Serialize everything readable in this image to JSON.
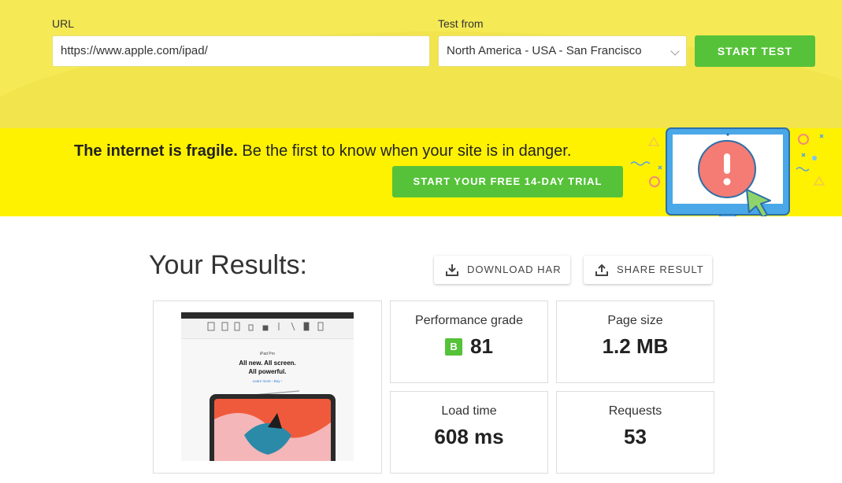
{
  "form": {
    "url_label": "URL",
    "url_value": "https://www.apple.com/ipad/",
    "test_from_label": "Test from",
    "test_from_value": "North America - USA - San Francisco",
    "start_test_label": "START TEST"
  },
  "banner": {
    "headline_bold": "The internet is fragile.",
    "headline_rest": " Be the first to know when your site is in danger.",
    "trial_label": "START YOUR FREE 14-DAY TRIAL"
  },
  "results": {
    "title": "Your Results:",
    "download_har_label": "DOWNLOAD HAR",
    "share_result_label": "SHARE RESULT",
    "performance_grade_label": "Performance grade",
    "performance_grade_letter": "B",
    "performance_grade_value": "81",
    "page_size_label": "Page size",
    "page_size_value": "1.2 MB",
    "load_time_label": "Load time",
    "load_time_value": "608 ms",
    "requests_label": "Requests",
    "requests_value": "53"
  },
  "preview": {
    "nav": [
      "Mac",
      "iPad",
      "iPhone",
      "Watch",
      "TV",
      "Music",
      "Support"
    ],
    "kicker": "iPad Pro",
    "headline_1": "All new. All screen.",
    "headline_2": "All powerful.",
    "links": "Learn more ›   Buy ›"
  },
  "colors": {
    "accent_green": "#56c23a",
    "banner_yellow": "#fff200",
    "form_yellow": "#f5ea55"
  }
}
